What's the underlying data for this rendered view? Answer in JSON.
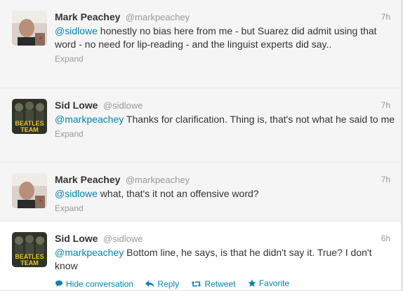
{
  "tweets": [
    {
      "fullname": "Mark Peachey",
      "username": "@markpeachey",
      "time": "7h",
      "mention": "@sidlowe",
      "text": " honestly no bias here from me - but Suarez did admit using that word - no need for lip-reading - and the linguist experts did say..",
      "expand": "Expand"
    },
    {
      "fullname": "Sid Lowe",
      "username": "@sidlowe",
      "time": "7h",
      "mention": "@markpeachey",
      "text": " Thanks for clarification. Thing is, that's not what he said to me",
      "expand": "Expand",
      "avatar_text_top": "BEATLES",
      "avatar_text_bottom": "TEAM"
    },
    {
      "fullname": "Mark Peachey",
      "username": "@markpeachey",
      "time": "7h",
      "mention": "@sidlowe",
      "text": " what, that's it not an offensive word?",
      "expand": "Expand"
    },
    {
      "fullname": "Sid Lowe",
      "username": "@sidlowe",
      "time": "6h",
      "mention": "@markpeachey",
      "text": " Bottom line, he says, is that he didn't say it. True? I don't know",
      "avatar_text_top": "BEATLES",
      "avatar_text_bottom": "TEAM",
      "actions": {
        "hide_conversation": "Hide conversation",
        "reply": "Reply",
        "retweet": "Retweet",
        "favorite": "Favorite"
      }
    }
  ],
  "colors": {
    "link": "#0084b4",
    "muted": "#999999",
    "text": "#333333",
    "selected_bg": "#f5f5f5"
  }
}
